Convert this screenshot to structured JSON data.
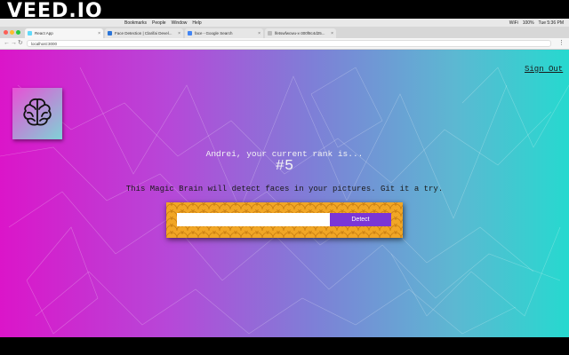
{
  "watermark": "VEED.IO",
  "menubar": {
    "items": [
      "Bookmarks",
      "People",
      "Window",
      "Help"
    ],
    "status": [
      "WiFi",
      "100%",
      "Tue 5:36 PM"
    ]
  },
  "tabs": [
    {
      "label": "React App",
      "color": "#61dafb"
    },
    {
      "label": "Face Detection | Clarifai Devel...",
      "color": "#2a74d8"
    },
    {
      "label": "face - Google Search",
      "color": "#4285f4"
    },
    {
      "label": "lfetswfwcwu-x-300f8c4d25...",
      "color": "#bbbbbb"
    }
  ],
  "address": {
    "url": "localhost:3000"
  },
  "nav": {
    "signout": "Sign Out"
  },
  "logo": {
    "icon": "brain-icon"
  },
  "rank": {
    "message": "Andrei, your current rank is...",
    "value": "#5"
  },
  "description": "This Magic Brain will detect faces in your pictures. Git it a try.",
  "form": {
    "input_value": "",
    "button_label": "Detect"
  },
  "colors": {
    "gradient_left": "#db15c9",
    "gradient_right": "#26d9cf",
    "form_bg": "#f1a625",
    "button_bg": "#7b36d6"
  }
}
